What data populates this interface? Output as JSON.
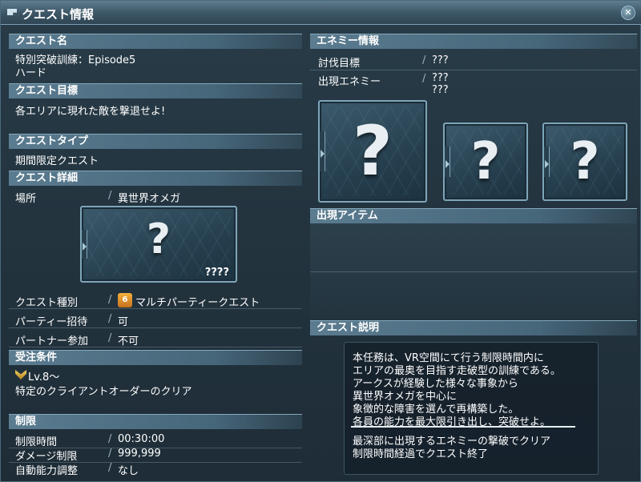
{
  "window": {
    "title": "クエスト情報",
    "close_label": "✕"
  },
  "left": {
    "quest_name": {
      "header": "クエスト名",
      "line1": "特別突破訓練：Episode5",
      "line2": "ハード"
    },
    "quest_goal": {
      "header": "クエスト目標",
      "text": "各エリアに現れた敵を撃退せよ!"
    },
    "quest_type": {
      "header": "クエストタイプ",
      "text": "期間限定クエスト"
    },
    "quest_detail": {
      "header": "クエスト詳細",
      "location_label": "場所",
      "location_value": "異世界オメガ",
      "card_mark": "?",
      "card_caption": "????",
      "quest_kind_label": "クエスト種別",
      "quest_kind_icon_text": "6",
      "quest_kind_value": "マルチパーティークエスト",
      "party_invite_label": "パーティー招待",
      "party_invite_value": "可",
      "partner_label": "パートナー参加",
      "partner_value": "不可"
    },
    "requirements": {
      "header": "受注条件",
      "level": "Lv.8～",
      "text": "特定のクライアントオーダーのクリア"
    },
    "limits": {
      "header": "制限",
      "time_label": "制限時間",
      "time_value": "00:30:00",
      "damage_label": "ダメージ制限",
      "damage_value": "999,999",
      "auto_label": "自動能力調整",
      "auto_value": "なし"
    }
  },
  "right": {
    "enemy": {
      "header": "エネミー情報",
      "target_label": "討伐目標",
      "target_value": "???",
      "appear_label": "出現エネミー",
      "appear_value1": "???",
      "appear_value2": "???",
      "card_mark": "?"
    },
    "items": {
      "header": "出現アイテム"
    },
    "description": {
      "header": "クエスト説明",
      "lines": [
        "本任務は、VR空間にて行う制限時間内に",
        "エリアの最奥を目指す走破型の訓練である。",
        "アークスが経験した様々な事象から",
        "異世界オメガを中心に",
        "象徴的な障害を選んで再構築した。",
        "各員の能力を最大限引き出し、突破せよ。",
        "最深部に出現するエネミーの撃破でクリア",
        "制限時間経過でクエスト終了"
      ]
    }
  }
}
